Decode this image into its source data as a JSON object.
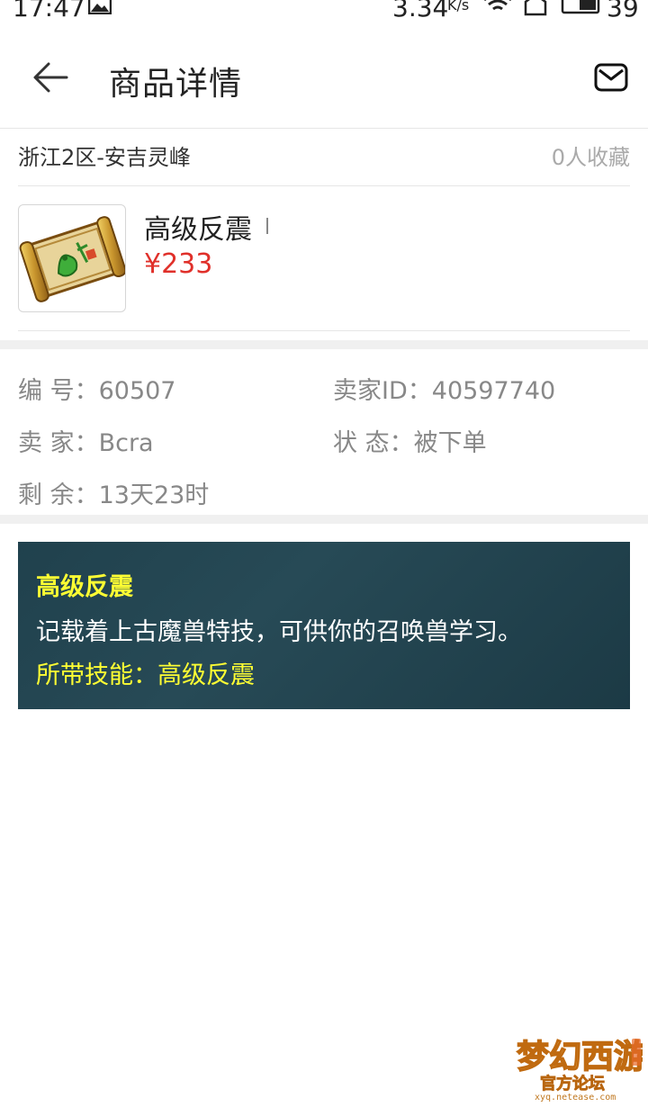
{
  "status_bar": {
    "time": "17:47",
    "speed": "3.34",
    "speed_unit": "K/s",
    "battery": "39"
  },
  "header": {
    "title": "商品详情"
  },
  "server_row": {
    "server": "浙江2区-安吉灵峰",
    "favorites": "0人收藏"
  },
  "item": {
    "name": "高级反震",
    "price": "¥233"
  },
  "info": {
    "id_label": "编 号：",
    "id_value": "60507",
    "seller_id_label": "卖家ID：",
    "seller_id_value": "40597740",
    "seller_label": "卖 家：",
    "seller_value": "Bcra",
    "status_label": "状 态：",
    "status_value": "被下单",
    "remaining_label": "剩 余：",
    "remaining_value": "13天23时"
  },
  "description": {
    "title": "高级反震",
    "text": "记载着上古魔兽特技，可供你的召唤兽学习。",
    "skill": "所带技能：高级反震"
  },
  "watermark": {
    "text": "梦幻西游",
    "sub": "官方论坛",
    "url": "xyq.netease.com"
  },
  "colors": {
    "price": "#e0302a",
    "desc_bg": "#1f3f4b",
    "desc_highlight": "#ffff33"
  },
  "icons": [
    "image-icon",
    "wifi-icon",
    "home-icon",
    "battery-icon",
    "back-arrow-icon",
    "mail-icon",
    "scroll-item-icon"
  ]
}
